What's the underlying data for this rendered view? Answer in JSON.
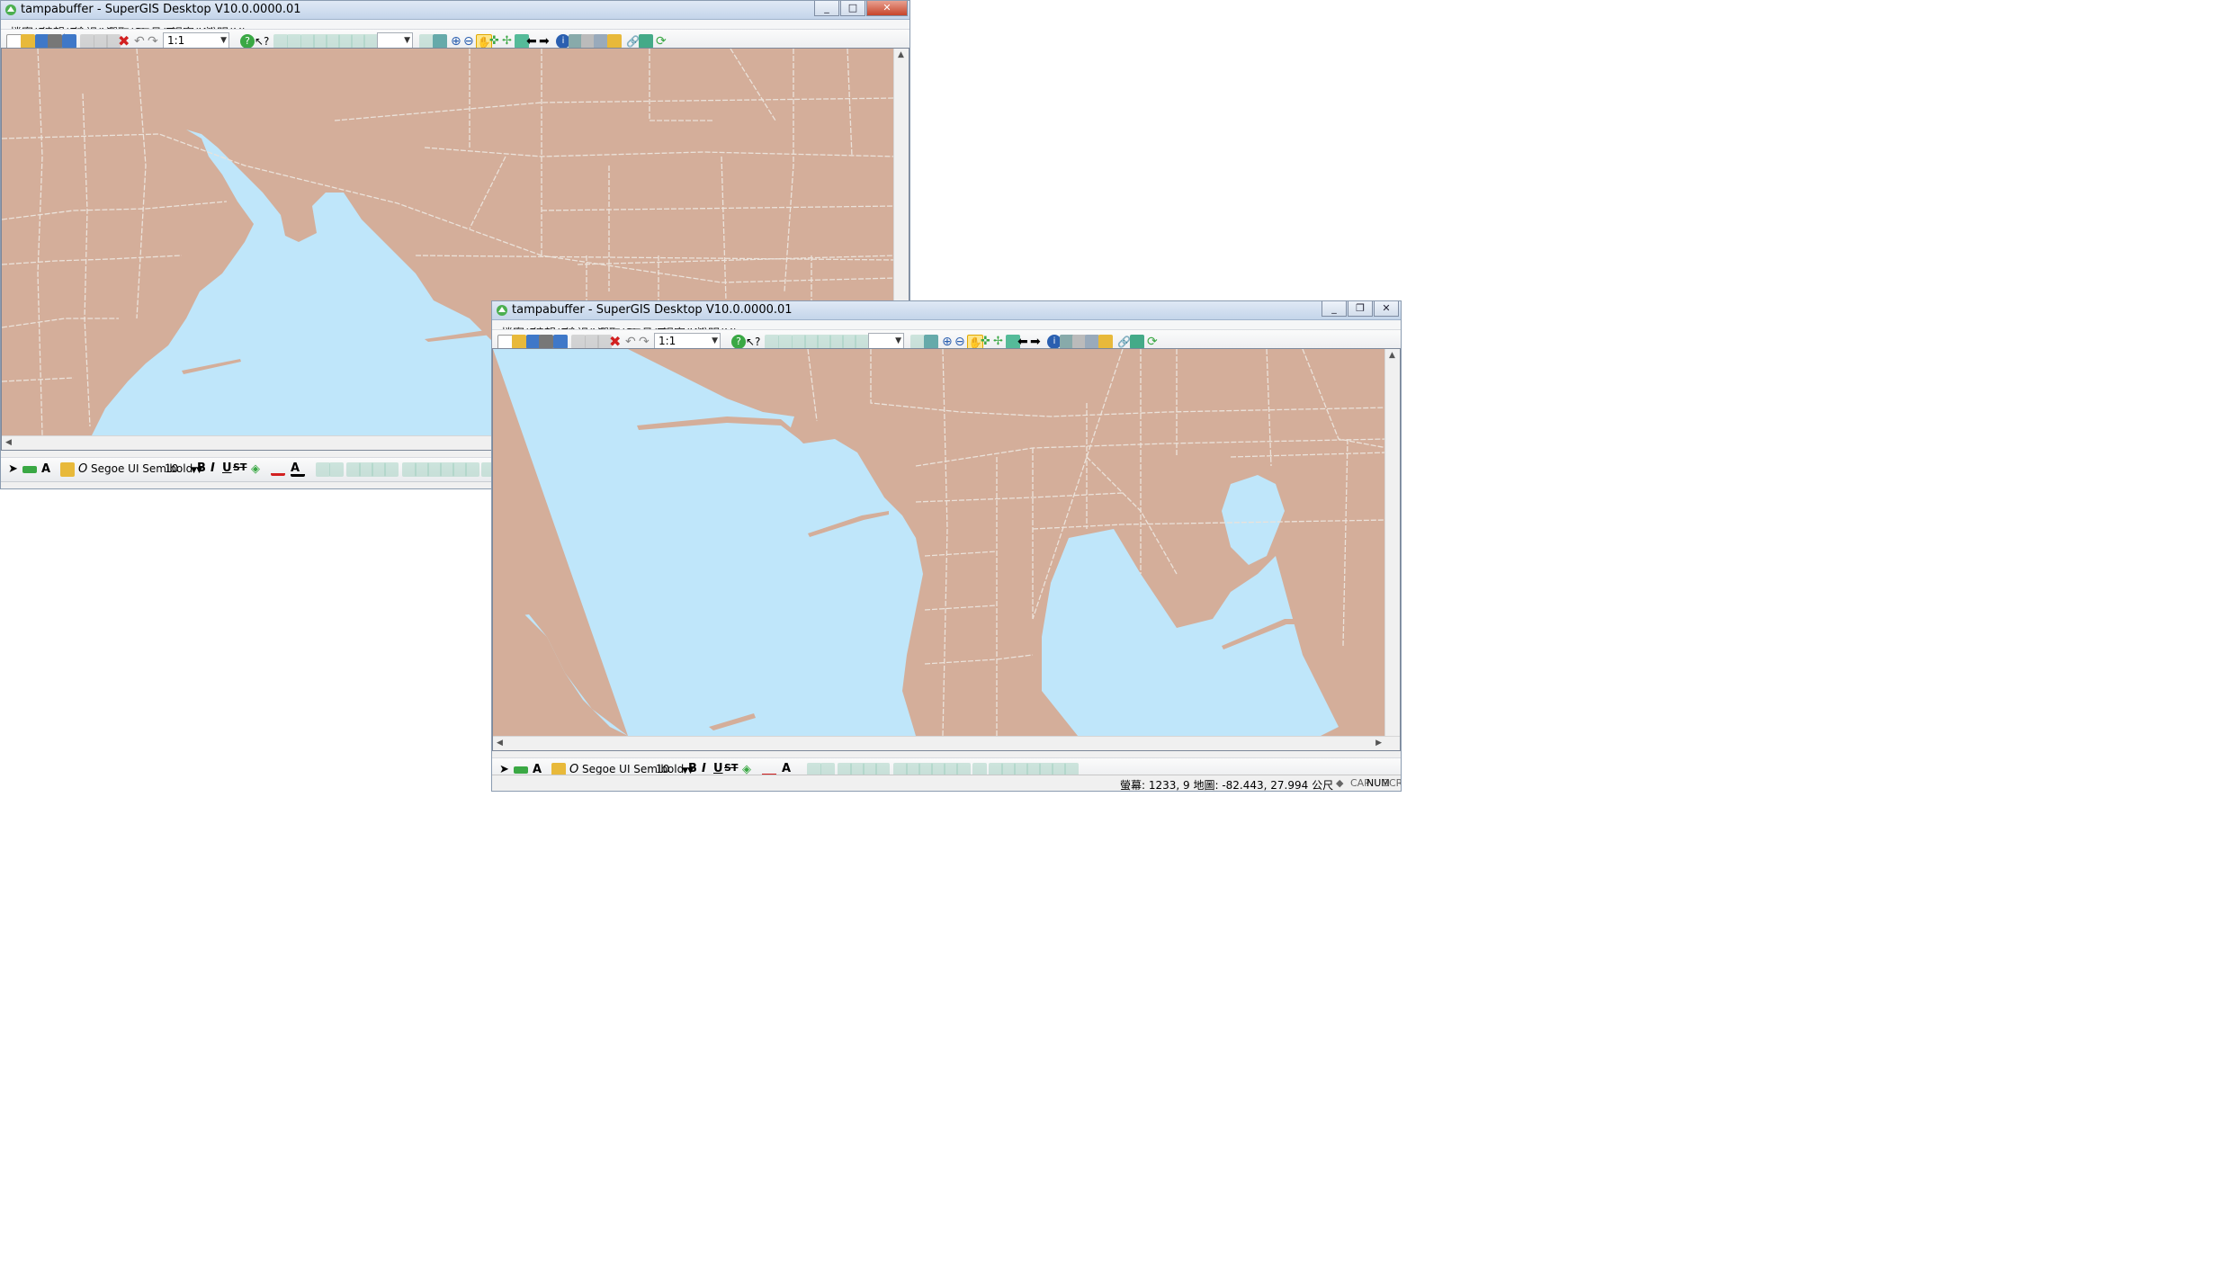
{
  "back_window": {
    "title": "tampabuffer - SuperGIS Desktop V10.0.0000.01",
    "menu": [
      "檔案(F)",
      "編輯(E)",
      "檢視(V)",
      "選取(S)",
      "工具(T)",
      "視窗(W)",
      "說明(H)"
    ],
    "scale": "1:1",
    "font_name": "Segoe UI Semibold",
    "font_size": "10",
    "fmt": [
      "B",
      "I",
      "U",
      "ST"
    ]
  },
  "front_window": {
    "title": "tampabuffer - SuperGIS Desktop V10.0.0000.01",
    "menu": [
      "檔案(F)",
      "編輯(E)",
      "檢視(V)",
      "選取(S)",
      "工具(T)",
      "視窗(W)",
      "說明(H)"
    ],
    "scale": "1:1",
    "font_name": "Segoe UI Semibold",
    "font_size": "10",
    "fmt": [
      "B",
      "I",
      "U",
      "ST"
    ],
    "status": {
      "coords": "螢幕: 1233, 9  地圖: -82.443, 27.994 公尺",
      "indicators": [
        "CAP",
        "NUM",
        "SCRL"
      ]
    }
  },
  "colors": {
    "land": "#d4ae9a",
    "water": "#bfe6fa",
    "roads": "#ebe2da",
    "icon_blue": "#3f78c8",
    "icon_green": "#3aa844",
    "icon_red": "#d22020",
    "icon_yellow": "#e8b93a"
  },
  "icons": [
    "new-icon",
    "open-icon",
    "save-icon",
    "print-icon",
    "cut-icon",
    "copy-icon",
    "paste-icon",
    "delete-icon",
    "undo-icon",
    "redo-icon",
    "help-icon",
    "whats-this-icon",
    "zoom-in-icon",
    "zoom-out-icon",
    "pan-icon",
    "full-extent-icon",
    "identify-icon",
    "refresh-icon"
  ]
}
